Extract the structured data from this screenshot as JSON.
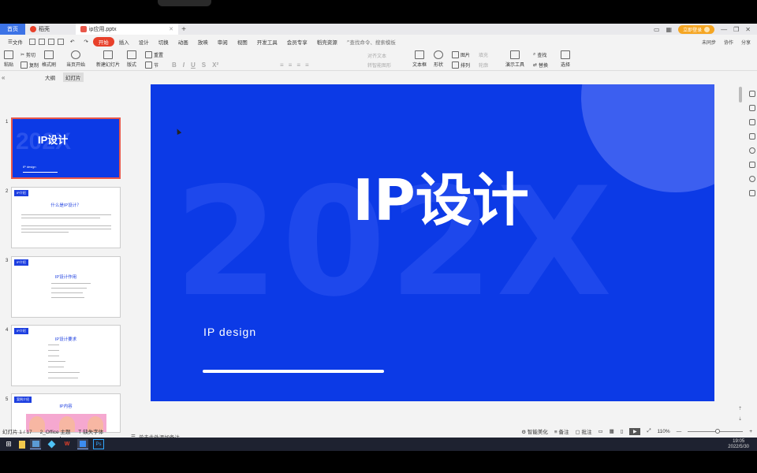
{
  "tabs": [
    {
      "label": "首页",
      "active": true
    },
    {
      "label": "稻壳"
    },
    {
      "label": "ip应用.pptx"
    }
  ],
  "tabbar": {
    "login_label": "立即登录"
  },
  "menubar": {
    "file_label": "文件",
    "items": [
      "开始",
      "插入",
      "设计",
      "切换",
      "动画",
      "放映",
      "审阅",
      "视图",
      "开发工具",
      "会员专享",
      "稻壳资源"
    ],
    "active_item": "开始",
    "search_placeholder": "查找命令、搜索模板",
    "right": [
      "未同步",
      "协作",
      "分享"
    ]
  },
  "ribbon": {
    "paste": "粘贴",
    "cut": "剪切",
    "copy": "复制",
    "format_painter": "格式刷",
    "from_start": "当页开始",
    "new_slide": "新建幻灯片",
    "layout": "版式",
    "section": "节",
    "reset": "重置",
    "text_box": "文本框",
    "shape": "形状",
    "arrange": "排列",
    "image": "图片",
    "fill": "填充",
    "outline": "轮廓",
    "present_tools": "演示工具",
    "find": "查找",
    "replace": "替换",
    "select": "选择",
    "text_direction": "对齐文本",
    "smart_art": "转智能图形"
  },
  "leftpanel": {
    "tab_outline": "大纲",
    "tab_slides": "幻灯片",
    "slides": [
      {
        "no": "1",
        "title": "IP设计",
        "sub": "IP design"
      },
      {
        "no": "2",
        "tag": "IP介绍",
        "title": "什么是IP设计？"
      },
      {
        "no": "3",
        "tag": "IP介绍",
        "title": "IP设计作用"
      },
      {
        "no": "4",
        "tag": "IP介绍",
        "title": "IP设计要求"
      },
      {
        "no": "5",
        "tag": "案例介绍",
        "title": "IP内容"
      }
    ],
    "add_label": "+"
  },
  "slide": {
    "watermark": "202X",
    "title": "IP设计",
    "subtitle": "IP design"
  },
  "notes": {
    "placeholder": "单击此处添加备注"
  },
  "statusbar": {
    "slide_counter": "幻灯片 1 / 17",
    "theme": "2_Office 主题",
    "missing_font": "缺失字体",
    "smart_beautify": "智能美化",
    "notes_label": "备注",
    "comments_label": "批注",
    "zoom": "110%",
    "zoom_fraction": 0.55
  },
  "taskbar": {
    "time": "19:05",
    "date": "2022/5/30"
  },
  "colors": {
    "slide_bg": "#0c3ae6",
    "accent": "#e8402a",
    "home_tab": "#3c73e6"
  }
}
